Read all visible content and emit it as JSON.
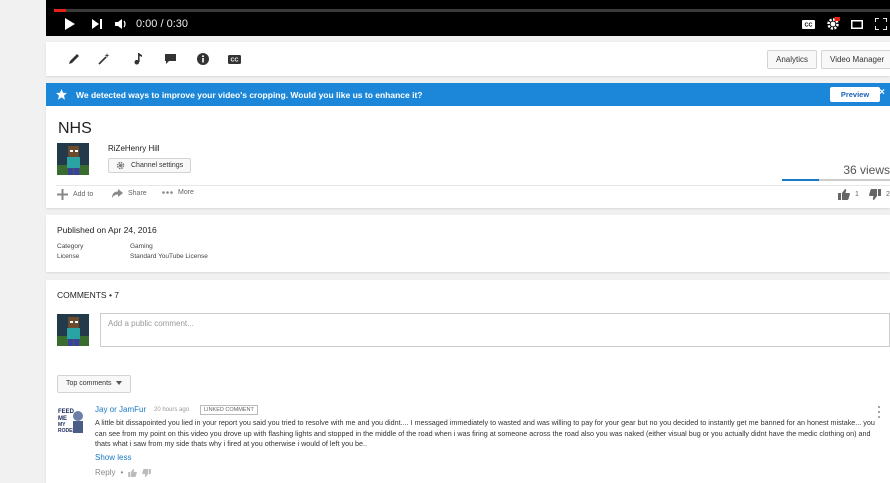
{
  "player": {
    "time": "0:00 / 0:30",
    "played_fraction": 0.014
  },
  "toolbar": {
    "analytics_label": "Analytics",
    "video_manager_label": "Video Manager"
  },
  "banner": {
    "message": "We detected ways to improve your video's cropping. Would you like us to enhance it?",
    "preview_label": "Preview",
    "close_glyph": "×"
  },
  "video": {
    "title": "NHS",
    "owner": "RiZeHenry Hill",
    "channel_settings_label": "Channel settings",
    "views": "36 views",
    "likes": "1",
    "dislikes": "2",
    "actions": {
      "add_to": "Add to",
      "share": "Share",
      "more": "More"
    }
  },
  "description": {
    "published": "Published on Apr 24, 2016",
    "category_label": "Category",
    "category_value": "Gaming",
    "license_label": "License",
    "license_value": "Standard YouTube License"
  },
  "comments": {
    "header": "COMMENTS • 7",
    "input_placeholder": "Add a public comment...",
    "sort_label": "Top comments",
    "items": [
      {
        "author": "Jay or JamFur",
        "time": "20 hours ago",
        "badge": "LINKED COMMENT",
        "avatar_text": "FEED ME\nMY\nRODENT",
        "text": "A little bit dissapointed you lied in your report you said you tried to resolve with me and you didnt.... I messaged immediately to wasted and was willing to pay for your gear but no you decided to instantly get me banned for an honest mistake... you can see from my point on this video you drove up with flashing lights and stopped in the middle of the road when i was firing at someone across the road also you was naked (either visual bug or you actually didnt have the medic clothing on) and thats what i saw from my side thats why i fired at you otherwise i would of left you be..",
        "show_less": "Show less",
        "reply": "Reply",
        "separator": "•"
      }
    ]
  },
  "colors": {
    "accent_blue": "#167ac6",
    "banner_blue": "#1c87d8",
    "youtube_red": "#e62117"
  }
}
